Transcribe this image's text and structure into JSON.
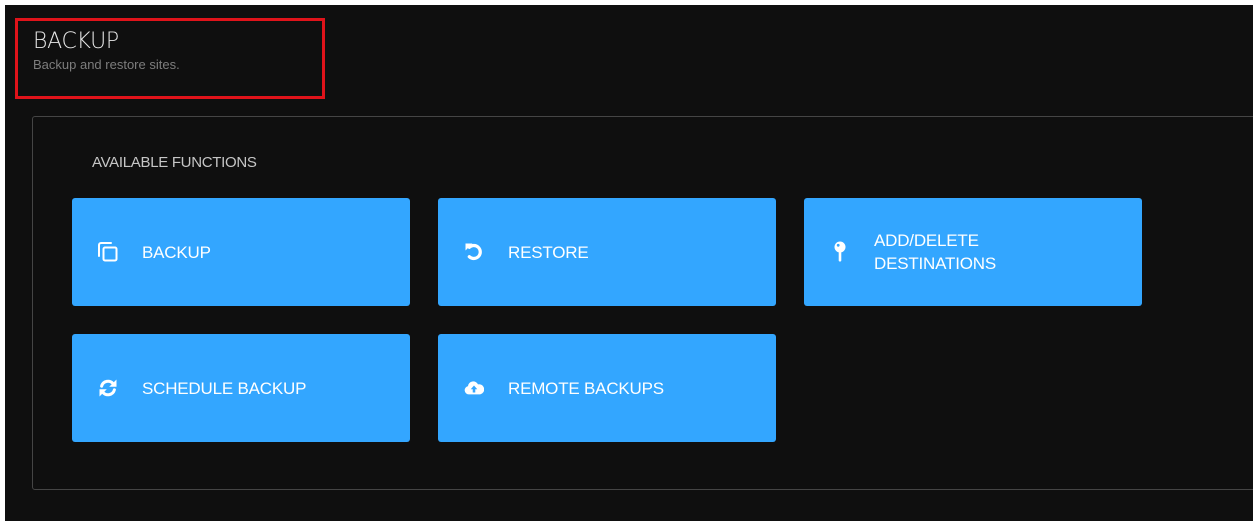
{
  "header": {
    "title": "BACKUP",
    "subtitle": "Backup and restore sites."
  },
  "panel": {
    "section_label": "AVAILABLE FUNCTIONS",
    "buttons": [
      {
        "label": "BACKUP",
        "icon": "copy-icon"
      },
      {
        "label": "RESTORE",
        "icon": "undo-icon"
      },
      {
        "label": "ADD/DELETE DESTINATIONS",
        "icon": "pushpin-icon"
      },
      {
        "label": "SCHEDULE BACKUP",
        "icon": "refresh-icon"
      },
      {
        "label": "REMOTE BACKUPS",
        "icon": "cloud-upload-icon"
      }
    ]
  },
  "colors": {
    "background": "#0f0f0f",
    "button": "#33a6ff",
    "highlight": "#e0131a",
    "panel_border": "#454545"
  }
}
